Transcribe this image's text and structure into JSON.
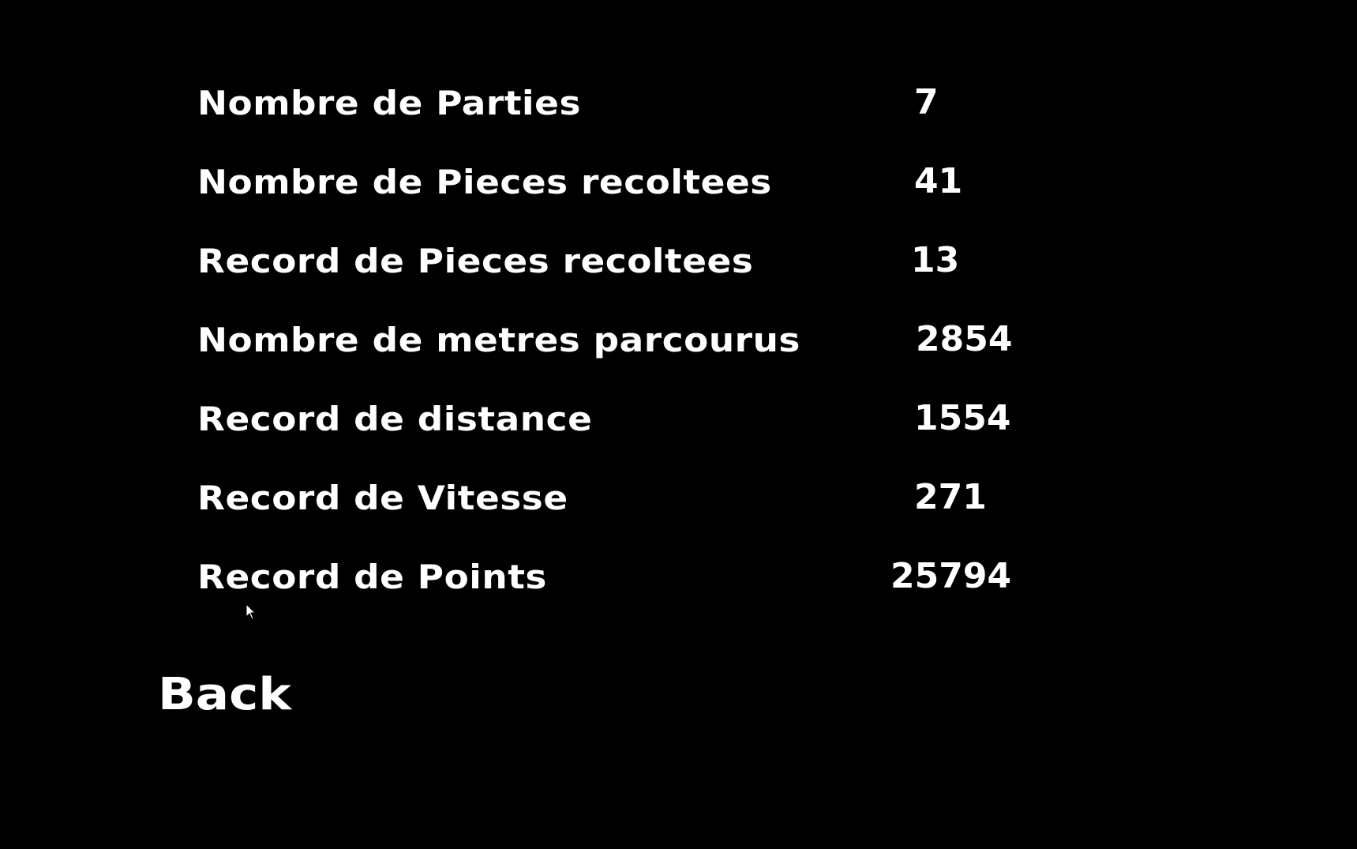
{
  "stats": [
    {
      "label": "Nombre de Parties",
      "value": "7"
    },
    {
      "label": "Nombre de Pieces recoltees",
      "value": "41"
    },
    {
      "label": "Record de Pieces recoltees",
      "value": "13"
    },
    {
      "label": "Nombre de metres parcourus",
      "value": "2854"
    },
    {
      "label": "Record de distance",
      "value": "1554"
    },
    {
      "label": "Record de Vitesse",
      "value": "271"
    },
    {
      "label": "Record de Points",
      "value": "25794"
    }
  ],
  "back": {
    "label": "Back"
  },
  "colors": {
    "background": "#000000",
    "text": "#ffffff"
  },
  "cursor": {
    "icon": "mouse-pointer-icon"
  }
}
